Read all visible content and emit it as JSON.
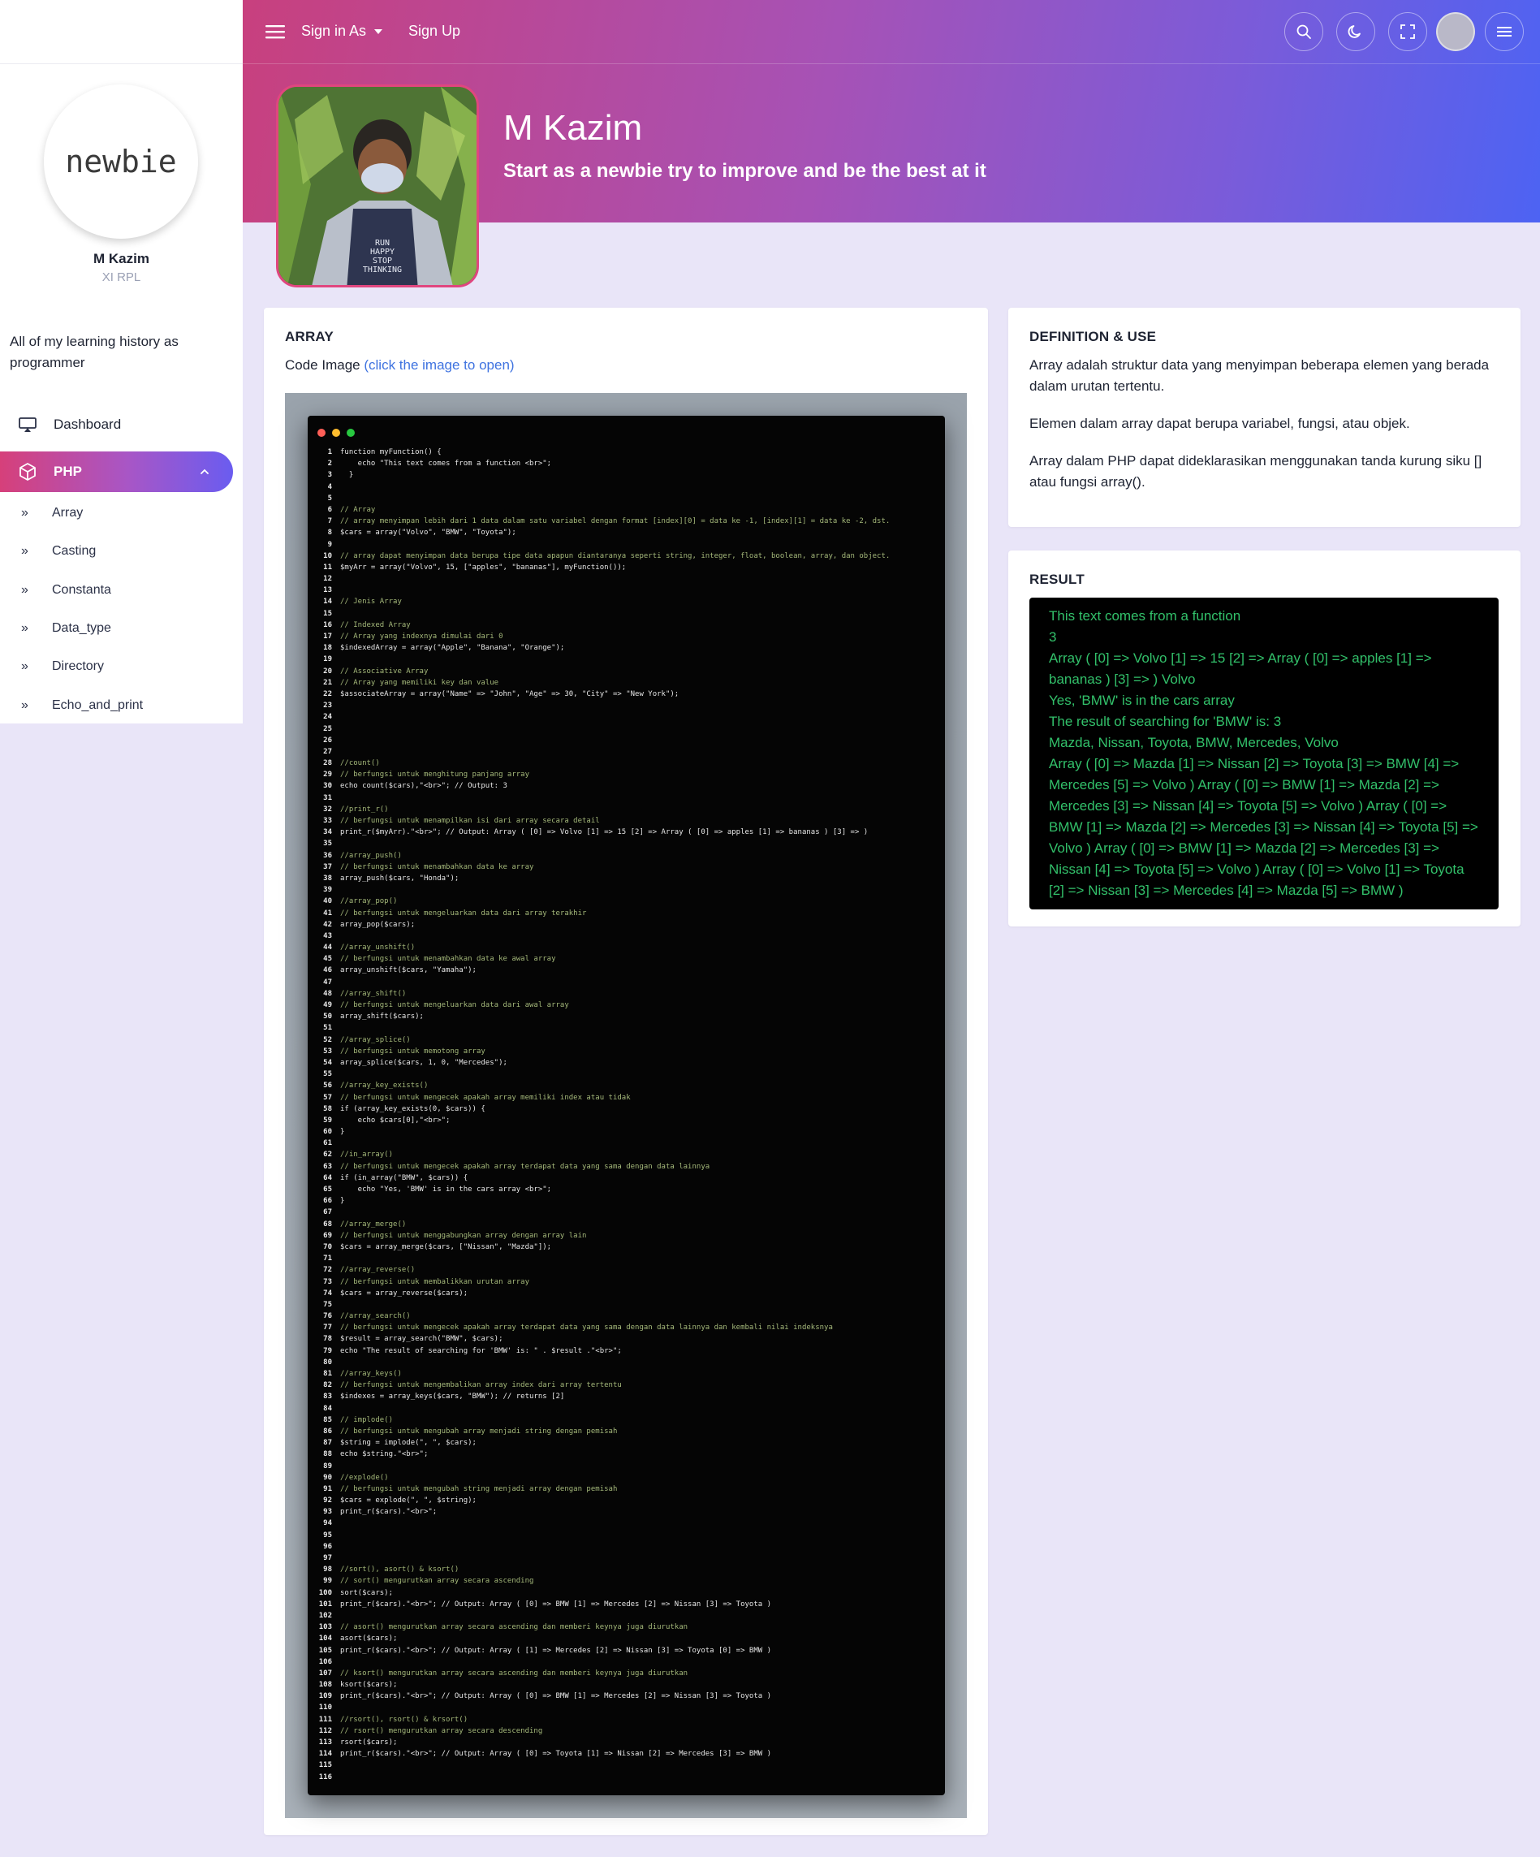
{
  "sidebar": {
    "logo_text": "newbie",
    "profile_name": "M Kazim",
    "profile_class": "XI RPL",
    "description": "All of my learning history as programmer",
    "nav": {
      "dashboard": "Dashboard",
      "php": "PHP",
      "sub_items": [
        "Array",
        "Casting",
        "Constanta",
        "Data_type",
        "Directory",
        "Echo_and_print"
      ]
    }
  },
  "topbar": {
    "signin_label": "Sign in As",
    "signup_label": "Sign Up"
  },
  "hero": {
    "title": "M Kazim",
    "subtitle": "Start as a newbie try to improve and be the best at it",
    "shirt_text": "RUN\nHAPPY\nSTOP\nTHINKING"
  },
  "array_card": {
    "title": "ARRAY",
    "code_label": "Code Image",
    "code_link": "(click the image to open)",
    "code_lines": [
      {
        "n": "1",
        "t": "function myFunction() {",
        "c": false
      },
      {
        "n": "2",
        "t": "    echo \"This text comes from a function <br>\";",
        "c": false
      },
      {
        "n": "3",
        "t": "  }",
        "c": false
      },
      {
        "n": "4",
        "t": "",
        "c": false
      },
      {
        "n": "5",
        "t": "",
        "c": false
      },
      {
        "n": "6",
        "t": "// Array",
        "c": true
      },
      {
        "n": "7",
        "t": "// array menyimpan lebih dari 1 data dalam satu variabel dengan format [index][0] = data ke -1, [index][1] = data ke -2, dst.",
        "c": true
      },
      {
        "n": "8",
        "t": "$cars = array(\"Volvo\", \"BMW\", \"Toyota\");",
        "c": false
      },
      {
        "n": "9",
        "t": "",
        "c": false
      },
      {
        "n": "10",
        "t": "// array dapat menyimpan data berupa tipe data apapun diantaranya seperti string, integer, float, boolean, array, dan object.",
        "c": true
      },
      {
        "n": "11",
        "t": "$myArr = array(\"Volvo\", 15, [\"apples\", \"bananas\"], myFunction());",
        "c": false
      },
      {
        "n": "12",
        "t": "",
        "c": false
      },
      {
        "n": "13",
        "t": "",
        "c": false
      },
      {
        "n": "14",
        "t": "// Jenis Array",
        "c": true
      },
      {
        "n": "15",
        "t": "",
        "c": false
      },
      {
        "n": "16",
        "t": "// Indexed Array",
        "c": true
      },
      {
        "n": "17",
        "t": "// Array yang indexnya dimulai dari 0",
        "c": true
      },
      {
        "n": "18",
        "t": "$indexedArray = array(\"Apple\", \"Banana\", \"Orange\");",
        "c": false
      },
      {
        "n": "19",
        "t": "",
        "c": false
      },
      {
        "n": "20",
        "t": "// Associative Array",
        "c": true
      },
      {
        "n": "21",
        "t": "// Array yang memiliki key dan value",
        "c": true
      },
      {
        "n": "22",
        "t": "$associateArray = array(\"Name\" => \"John\", \"Age\" => 30, \"City\" => \"New York\");",
        "c": false
      },
      {
        "n": "23",
        "t": "",
        "c": false
      },
      {
        "n": "24",
        "t": "",
        "c": false
      },
      {
        "n": "25",
        "t": "",
        "c": false
      },
      {
        "n": "26",
        "t": "",
        "c": false
      },
      {
        "n": "27",
        "t": "",
        "c": false
      },
      {
        "n": "28",
        "t": "//count()",
        "c": true
      },
      {
        "n": "29",
        "t": "// berfungsi untuk menghitung panjang array",
        "c": true
      },
      {
        "n": "30",
        "t": "echo count($cars),\"<br>\"; // Output: 3",
        "c": false
      },
      {
        "n": "31",
        "t": "",
        "c": false
      },
      {
        "n": "32",
        "t": "//print_r()",
        "c": true
      },
      {
        "n": "33",
        "t": "// berfungsi untuk menampilkan isi dari array secara detail",
        "c": true
      },
      {
        "n": "34",
        "t": "print_r($myArr).\"<br>\"; // Output: Array ( [0] => Volvo [1] => 15 [2] => Array ( [0] => apples [1] => bananas ) [3] => )",
        "c": false
      },
      {
        "n": "35",
        "t": "",
        "c": false
      },
      {
        "n": "36",
        "t": "//array_push()",
        "c": true
      },
      {
        "n": "37",
        "t": "// berfungsi untuk menambahkan data ke array",
        "c": true
      },
      {
        "n": "38",
        "t": "array_push($cars, \"Honda\");",
        "c": false
      },
      {
        "n": "39",
        "t": "",
        "c": false
      },
      {
        "n": "40",
        "t": "//array_pop()",
        "c": true
      },
      {
        "n": "41",
        "t": "// berfungsi untuk mengeluarkan data dari array terakhir",
        "c": true
      },
      {
        "n": "42",
        "t": "array_pop($cars);",
        "c": false
      },
      {
        "n": "43",
        "t": "",
        "c": false
      },
      {
        "n": "44",
        "t": "//array_unshift()",
        "c": true
      },
      {
        "n": "45",
        "t": "// berfungsi untuk menambahkan data ke awal array",
        "c": true
      },
      {
        "n": "46",
        "t": "array_unshift($cars, \"Yamaha\");",
        "c": false
      },
      {
        "n": "47",
        "t": "",
        "c": false
      },
      {
        "n": "48",
        "t": "//array_shift()",
        "c": true
      },
      {
        "n": "49",
        "t": "// berfungsi untuk mengeluarkan data dari awal array",
        "c": true
      },
      {
        "n": "50",
        "t": "array_shift($cars);",
        "c": false
      },
      {
        "n": "51",
        "t": "",
        "c": false
      },
      {
        "n": "52",
        "t": "//array_splice()",
        "c": true
      },
      {
        "n": "53",
        "t": "// berfungsi untuk memotong array",
        "c": true
      },
      {
        "n": "54",
        "t": "array_splice($cars, 1, 0, \"Mercedes\");",
        "c": false
      },
      {
        "n": "55",
        "t": "",
        "c": false
      },
      {
        "n": "56",
        "t": "//array_key_exists()",
        "c": true
      },
      {
        "n": "57",
        "t": "// berfungsi untuk mengecek apakah array memiliki index atau tidak",
        "c": true
      },
      {
        "n": "58",
        "t": "if (array_key_exists(0, $cars)) {",
        "c": false
      },
      {
        "n": "59",
        "t": "    echo $cars[0],\"<br>\";",
        "c": false
      },
      {
        "n": "60",
        "t": "}",
        "c": false
      },
      {
        "n": "61",
        "t": "",
        "c": false
      },
      {
        "n": "62",
        "t": "//in_array()",
        "c": true
      },
      {
        "n": "63",
        "t": "// berfungsi untuk mengecek apakah array terdapat data yang sama dengan data lainnya",
        "c": true
      },
      {
        "n": "64",
        "t": "if (in_array(\"BMW\", $cars)) {",
        "c": false
      },
      {
        "n": "65",
        "t": "    echo \"Yes, 'BMW' is in the cars array <br>\";",
        "c": false
      },
      {
        "n": "66",
        "t": "}",
        "c": false
      },
      {
        "n": "67",
        "t": "",
        "c": false
      },
      {
        "n": "68",
        "t": "//array_merge()",
        "c": true
      },
      {
        "n": "69",
        "t": "// berfungsi untuk menggabungkan array dengan array lain",
        "c": true
      },
      {
        "n": "70",
        "t": "$cars = array_merge($cars, [\"Nissan\", \"Mazda\"]);",
        "c": false
      },
      {
        "n": "71",
        "t": "",
        "c": false
      },
      {
        "n": "72",
        "t": "//array_reverse()",
        "c": true
      },
      {
        "n": "73",
        "t": "// berfungsi untuk membalikkan urutan array",
        "c": true
      },
      {
        "n": "74",
        "t": "$cars = array_reverse($cars);",
        "c": false
      },
      {
        "n": "75",
        "t": "",
        "c": false
      },
      {
        "n": "76",
        "t": "//array_search()",
        "c": true
      },
      {
        "n": "77",
        "t": "// berfungsi untuk mengecek apakah array terdapat data yang sama dengan data lainnya dan kembali nilai indeksnya",
        "c": true
      },
      {
        "n": "78",
        "t": "$result = array_search(\"BMW\", $cars);",
        "c": false
      },
      {
        "n": "79",
        "t": "echo \"The result of searching for 'BMW' is: \" . $result .\"<br>\";",
        "c": false
      },
      {
        "n": "80",
        "t": "",
        "c": false
      },
      {
        "n": "81",
        "t": "//array_keys()",
        "c": true
      },
      {
        "n": "82",
        "t": "// berfungsi untuk mengembalikan array index dari array tertentu",
        "c": true
      },
      {
        "n": "83",
        "t": "$indexes = array_keys($cars, \"BMW\"); // returns [2]",
        "c": false
      },
      {
        "n": "84",
        "t": "",
        "c": false
      },
      {
        "n": "85",
        "t": "// implode()",
        "c": true
      },
      {
        "n": "86",
        "t": "// berfungsi untuk mengubah array menjadi string dengan pemisah",
        "c": true
      },
      {
        "n": "87",
        "t": "$string = implode(\", \", $cars);",
        "c": false
      },
      {
        "n": "88",
        "t": "echo $string.\"<br>\";",
        "c": false
      },
      {
        "n": "89",
        "t": "",
        "c": false
      },
      {
        "n": "90",
        "t": "//explode()",
        "c": true
      },
      {
        "n": "91",
        "t": "// berfungsi untuk mengubah string menjadi array dengan pemisah",
        "c": true
      },
      {
        "n": "92",
        "t": "$cars = explode(\", \", $string);",
        "c": false
      },
      {
        "n": "93",
        "t": "print_r($cars).\"<br>\";",
        "c": false
      },
      {
        "n": "94",
        "t": "",
        "c": false
      },
      {
        "n": "95",
        "t": "",
        "c": false
      },
      {
        "n": "96",
        "t": "",
        "c": false
      },
      {
        "n": "97",
        "t": "",
        "c": false
      },
      {
        "n": "98",
        "t": "//sort(), asort() & ksort()",
        "c": true
      },
      {
        "n": "99",
        "t": "// sort() mengurutkan array secara ascending",
        "c": true
      },
      {
        "n": "100",
        "t": "sort($cars);",
        "c": false
      },
      {
        "n": "101",
        "t": "print_r($cars).\"<br>\"; // Output: Array ( [0] => BMW [1] => Mercedes [2] => Nissan [3] => Toyota )",
        "c": false
      },
      {
        "n": "102",
        "t": "",
        "c": false
      },
      {
        "n": "103",
        "t": "// asort() mengurutkan array secara ascending dan memberi keynya juga diurutkan",
        "c": true
      },
      {
        "n": "104",
        "t": "asort($cars);",
        "c": false
      },
      {
        "n": "105",
        "t": "print_r($cars).\"<br>\"; // Output: Array ( [1] => Mercedes [2] => Nissan [3] => Toyota [0] => BMW )",
        "c": false
      },
      {
        "n": "106",
        "t": "",
        "c": false
      },
      {
        "n": "107",
        "t": "// ksort() mengurutkan array secara ascending dan memberi keynya juga diurutkan",
        "c": true
      },
      {
        "n": "108",
        "t": "ksort($cars);",
        "c": false
      },
      {
        "n": "109",
        "t": "print_r($cars).\"<br>\"; // Output: Array ( [0] => BMW [1] => Mercedes [2] => Nissan [3] => Toyota )",
        "c": false
      },
      {
        "n": "110",
        "t": "",
        "c": false
      },
      {
        "n": "111",
        "t": "//rsort(), rsort() & krsort()",
        "c": true
      },
      {
        "n": "112",
        "t": "// rsort() mengurutkan array secara descending",
        "c": true
      },
      {
        "n": "113",
        "t": "rsort($cars);",
        "c": false
      },
      {
        "n": "114",
        "t": "print_r($cars).\"<br>\"; // Output: Array ( [0] => Toyota [1] => Nissan [2] => Mercedes [3] => BMW )",
        "c": false
      },
      {
        "n": "115",
        "t": "",
        "c": false
      },
      {
        "n": "116",
        "t": "",
        "c": false
      }
    ]
  },
  "definition_card": {
    "title": "DEFINITION & USE",
    "paragraphs": [
      "Array adalah struktur data yang menyimpan beberapa elemen yang berada dalam urutan tertentu.",
      "Elemen dalam array dapat berupa variabel, fungsi, atau objek.",
      "Array dalam PHP dapat dideklarasikan menggunakan tanda kurung siku [] atau fungsi array()."
    ]
  },
  "result_card": {
    "title": "RESULT",
    "lines": [
      "This text comes from a function",
      "3",
      "Array ( [0] => Volvo [1] => 15 [2] => Array ( [0] => apples [1] => bananas ) [3] => ) Volvo",
      "Yes, 'BMW' is in the cars array",
      "The result of searching for 'BMW' is: 3",
      "Mazda, Nissan, Toyota, BMW, Mercedes, Volvo",
      "Array ( [0] => Mazda [1] => Nissan [2] => Toyota [3] => BMW [4] => Mercedes [5] => Volvo ) Array ( [0] => BMW [1] => Mazda [2] => Mercedes [3] => Nissan [4] => Toyota [5] => Volvo ) Array ( [0] => BMW [1] => Mazda [2] => Mercedes [3] => Nissan [4] => Toyota [5] => Volvo ) Array ( [0] => BMW [1] => Mazda [2] => Mercedes [3] => Nissan [4] => Toyota [5] => Volvo ) Array ( [0] => Volvo [1] => Toyota [2] => Nissan [3] => Mercedes [4] => Mazda [5] => BMW )"
    ]
  },
  "colors": {
    "accent_pink": "#d6407a",
    "accent_blue": "#4d63f3",
    "page_bg": "#e9e5f8",
    "result_text": "#32c06a",
    "code_comment": "#a4b87a"
  },
  "icons": {
    "menu": "hamburger-icon",
    "search": "search-icon",
    "theme": "moon-icon",
    "fullscreen": "fullscreen-icon",
    "more": "menu-icon",
    "dashboard": "monitor-icon",
    "php": "cube-icon",
    "expand": "chevron-up-icon",
    "subitem": "double-chevron-right-icon"
  }
}
